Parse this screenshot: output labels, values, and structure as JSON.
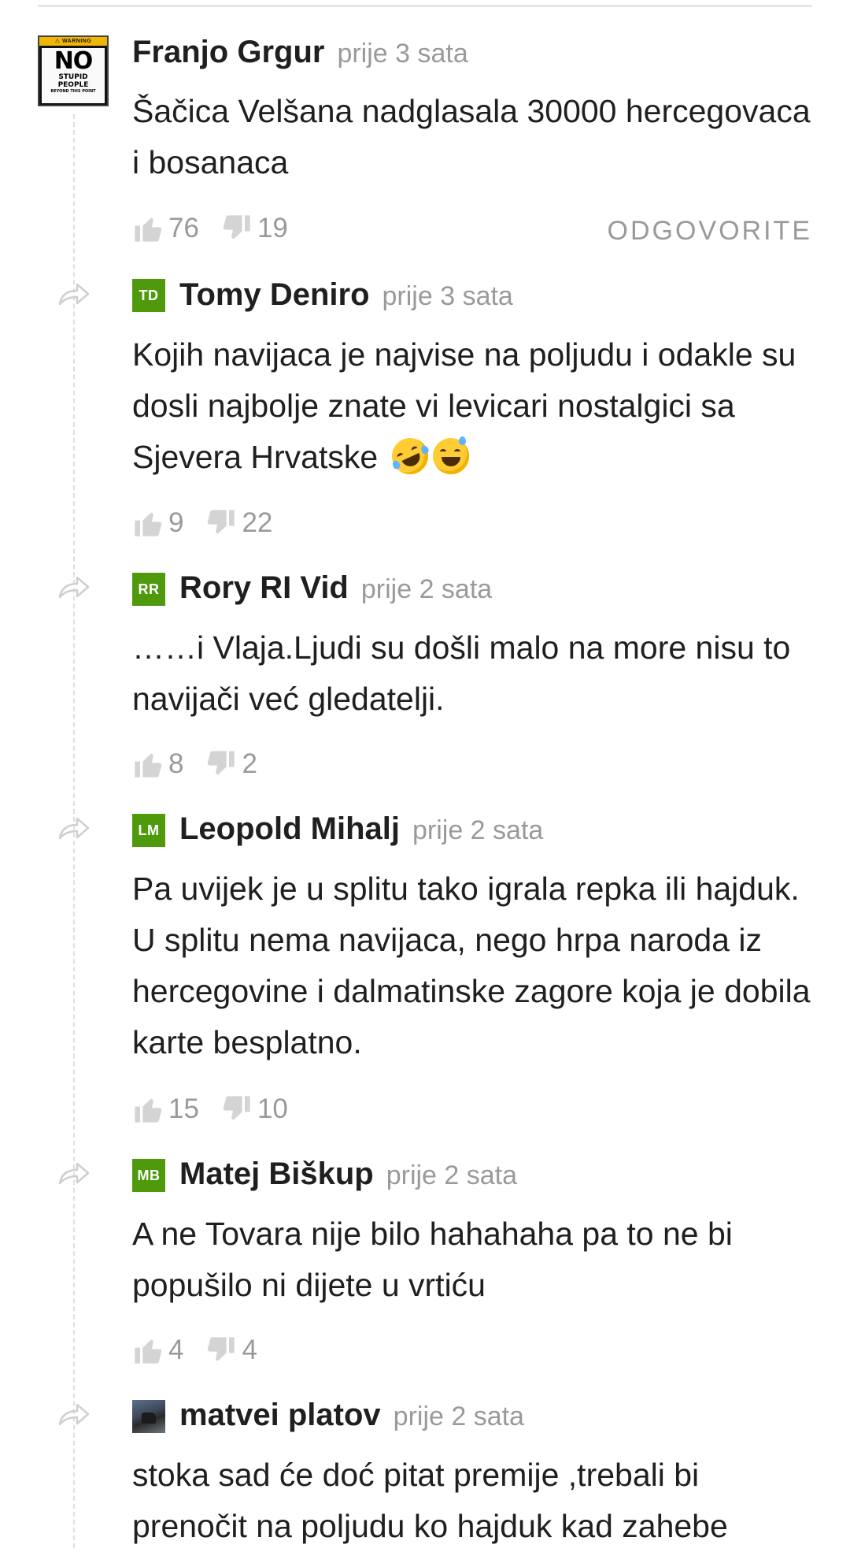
{
  "comments": [
    {
      "author": "Franjo Grgur",
      "time": "prije 3 sata",
      "text": "Šačica Velšana nadglasala 30000 hercegovaca i bosanaca",
      "likes": "76",
      "dislikes": "19",
      "reply_label": "ODGOVORITE",
      "avatar_text": {
        "warning": "⚠ WARNING",
        "big": "NO",
        "line1": "STUPID",
        "line2": "PEOPLE",
        "line3": "BEYOND THIS POINT"
      }
    },
    {
      "author": "Tomy Deniro",
      "initials": "TD",
      "time": "prije 3 sata",
      "text": "Kojih navijaca je najvise na poljudu i odakle su dosli najbolje znate vi levicari nostalgici sa Sjevera Hrvatske",
      "emojis": [
        "rolling-on-floor-laughing-emoji",
        "grinning-sweat-emoji"
      ],
      "likes": "9",
      "dislikes": "22"
    },
    {
      "author": "Rory RI Vid",
      "initials": "RR",
      "time": "prije 2 sata",
      "text": "……i Vlaja.Ljudi su došli malo na more nisu to navijači već gledatelji.",
      "likes": "8",
      "dislikes": "2"
    },
    {
      "author": "Leopold Mihalj",
      "initials": "LM",
      "time": "prije 2 sata",
      "text": "Pa uvijek je u splitu tako igrala repka ili hajduk. U splitu nema navijaca, nego hrpa naroda iz hercegovine i dalmatinske zagore koja je dobila karte besplatno.",
      "likes": "15",
      "dislikes": "10"
    },
    {
      "author": "Matej Biškup",
      "initials": "MB",
      "time": "prije 2 sata",
      "text": "A ne Tovara nije bilo hahahaha pa to ne bi popušilo ni dijete u vrtiću",
      "likes": "4",
      "dislikes": "4"
    },
    {
      "author": "matvei platov",
      "time": "prije 2 sata",
      "text": "stoka sad će doć pitat premije ,trebali bi prenočit na poljudu ko hajduk kad zahebe"
    }
  ],
  "colors": {
    "initials_bg": "#4f9a0c",
    "muted": "#9a9a9a",
    "text": "#1f1f1f"
  },
  "icons": [
    "thumbs-up-icon",
    "thumbs-down-icon",
    "reply-arrow-icon"
  ]
}
